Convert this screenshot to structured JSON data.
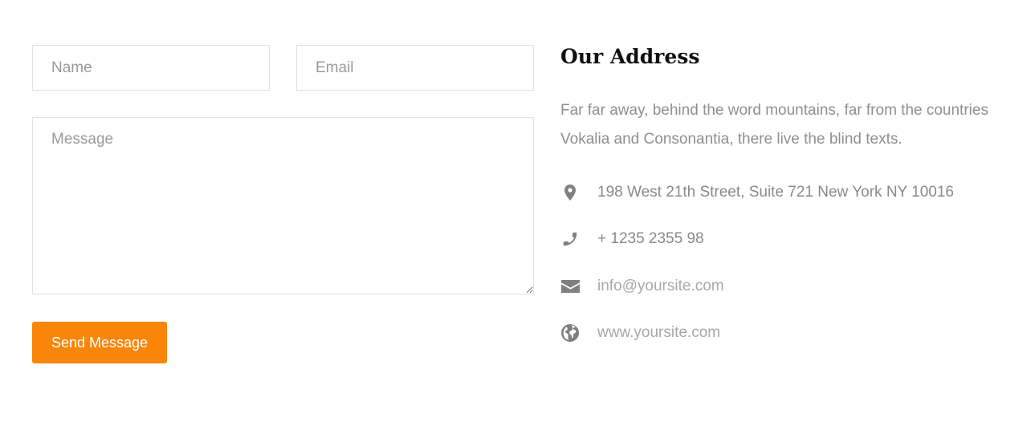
{
  "form": {
    "name_placeholder": "Name",
    "email_placeholder": "Email",
    "message_placeholder": "Message",
    "send_label": "Send Message"
  },
  "contact": {
    "title": "Our Address",
    "description": "Far far away, behind the word mountains, far from the countries Vokalia and Consonantia, there live the blind texts.",
    "items": [
      {
        "icon": "map-marker-icon",
        "text": "198 West 21th Street, Suite 721 New York NY 10016"
      },
      {
        "icon": "phone-icon",
        "text": "+ 1235 2355 98"
      },
      {
        "icon": "envelope-icon",
        "text": "info@yoursite.com"
      },
      {
        "icon": "globe-icon",
        "text": "www.yoursite.com"
      }
    ]
  },
  "colors": {
    "accent": "#f98509",
    "icon": "#808080",
    "title": "#111111",
    "text": "#8f8f8f"
  }
}
